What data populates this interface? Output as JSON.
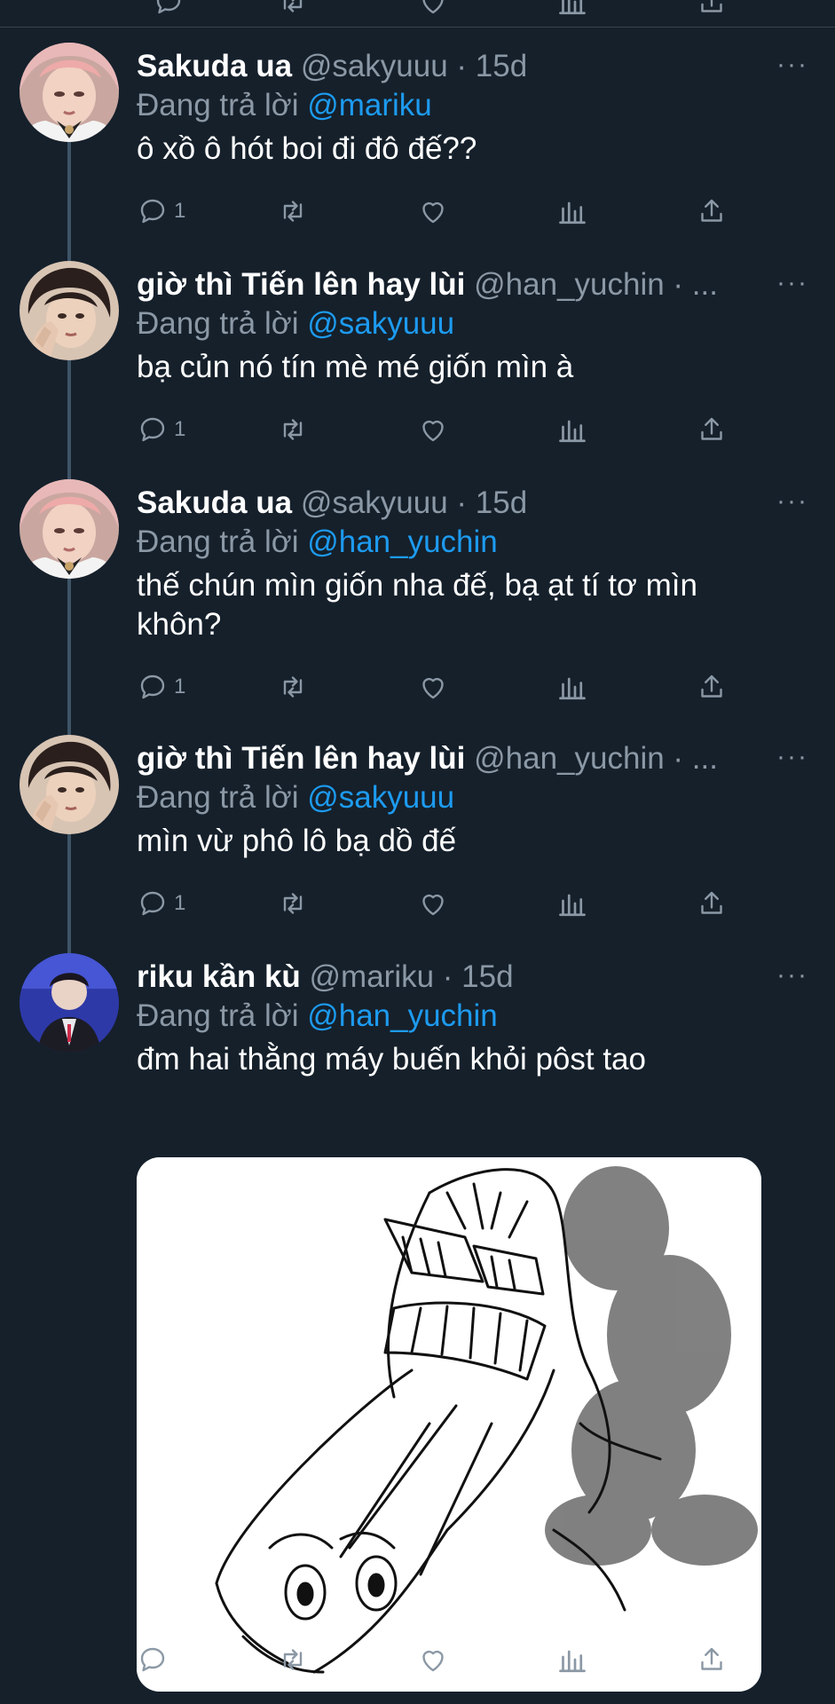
{
  "colors": {
    "background": "#15202b",
    "divider": "#38444d",
    "secondary_text": "#8b98a5",
    "mention": "#1d9bf0",
    "thread_line": "#3d5466"
  },
  "reply_prefix": "Đang trả lời",
  "more_label": "···",
  "tweets": [
    {
      "name": "Sakuda ua",
      "meta": "@sakyuuu · 15d",
      "mention": "@mariku",
      "text": "ô xồ ô hót boi đi đô đế??",
      "reply_count": "1",
      "avatar": "avatar-pink-hair-icon"
    },
    {
      "name": "giờ thì Tiến lên hay lùi",
      "meta": "@han_yuchin · ...",
      "mention": "@sakyuuu",
      "text": "bạ củn nó tín mè mé giốn mìn à",
      "reply_count": "1",
      "avatar": "avatar-dark-hair-icon"
    },
    {
      "name": "Sakuda ua",
      "meta": "@sakyuuu · 15d",
      "mention": "@han_yuchin",
      "text": "thế chún mìn giốn nha đế, bạ ạt tí tơ mìn khôn?",
      "reply_count": "1",
      "avatar": "avatar-pink-hair-icon"
    },
    {
      "name": "giờ thì Tiến lên hay lùi",
      "meta": "@han_yuchin · ...",
      "mention": "@sakyuuu",
      "text": "mìn vừ phô lô bạ dồ đế",
      "reply_count": "1",
      "avatar": "avatar-dark-hair-icon"
    },
    {
      "name": "riku kần kù",
      "meta": "@mariku · 15d",
      "mention": "@han_yuchin",
      "text": "đm hai thằng máy buến khỏi pôst tao",
      "reply_count": "",
      "avatar": "avatar-stage-icon",
      "media": "angry-shouting-sketch-image"
    }
  ]
}
